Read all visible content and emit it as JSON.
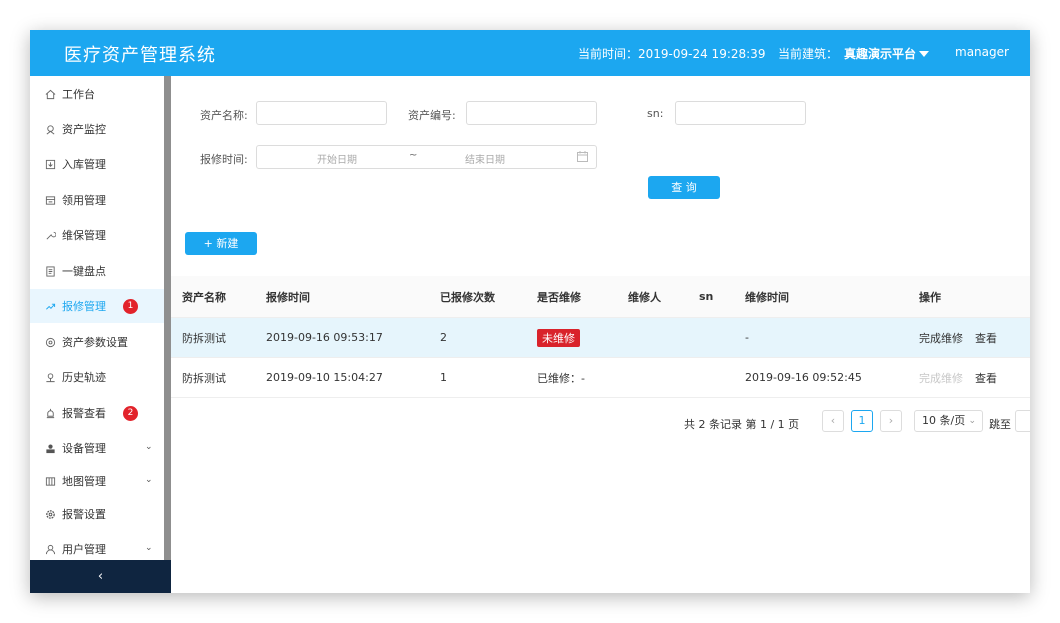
{
  "header": {
    "title": "医疗资产管理系统",
    "time_label": "当前时间：2019-09-24 19:28:39",
    "building_label": "当前建筑：",
    "building_value": "真趣演示平台",
    "user": "manager"
  },
  "sidebar": {
    "items": [
      {
        "label": "工作台",
        "icon": "home-icon"
      },
      {
        "label": "资产监控",
        "icon": "monitor-icon"
      },
      {
        "label": "入库管理",
        "icon": "inbound-icon"
      },
      {
        "label": "领用管理",
        "icon": "inbox-icon"
      },
      {
        "label": "维保管理",
        "icon": "wrench-icon"
      },
      {
        "label": "一键盘点",
        "icon": "document-icon"
      },
      {
        "label": "报修管理",
        "icon": "repair-icon",
        "badge": "1",
        "active": true
      },
      {
        "label": "资产参数设置",
        "icon": "target-icon"
      },
      {
        "label": "历史轨迹",
        "icon": "location-icon"
      },
      {
        "label": "报警查看",
        "icon": "alarm-icon",
        "badge": "2"
      },
      {
        "label": "设备管理",
        "icon": "device-icon",
        "expandable": true
      },
      {
        "label": "地图管理",
        "icon": "map-icon",
        "expandable": true
      },
      {
        "label": "报警设置",
        "icon": "gear-icon"
      },
      {
        "label": "用户管理",
        "icon": "user-icon",
        "expandable": true
      }
    ],
    "collapse_label": "‹"
  },
  "filters": {
    "asset_name_label": "资产名称:",
    "asset_code_label": "资产编号:",
    "sn_label": "sn:",
    "repair_time_label": "报修时间:",
    "start_date_placeholder": "开始日期",
    "range_sep": "~",
    "end_date_placeholder": "结束日期",
    "query_button": "查 询"
  },
  "new_button": "+ 新建",
  "table": {
    "headers": [
      "资产名称",
      "报修时间",
      "已报修次数",
      "是否维修",
      "维修人",
      "sn",
      "维修时间",
      "操作"
    ],
    "rows": [
      {
        "asset_name": "防拆测试",
        "repair_time": "2019-09-16 09:53:17",
        "count": "2",
        "status": "未维修",
        "repairer": "",
        "sn": "",
        "fix_time": "-",
        "action1": "完成维修",
        "action2": "查看"
      },
      {
        "asset_name": "防拆测试",
        "repair_time": "2019-09-10 15:04:27",
        "count": "1",
        "status": "已维修：-",
        "repairer": "",
        "sn": "",
        "fix_time": "2019-09-16 09:52:45",
        "action1": "完成维修",
        "action2": "查看"
      }
    ]
  },
  "pagination": {
    "summary": "共 2 条记录 第 1 / 1 页",
    "prev": "‹",
    "current_page": "1",
    "next": "›",
    "page_size": "10 条/页",
    "jump_label": "跳至"
  }
}
